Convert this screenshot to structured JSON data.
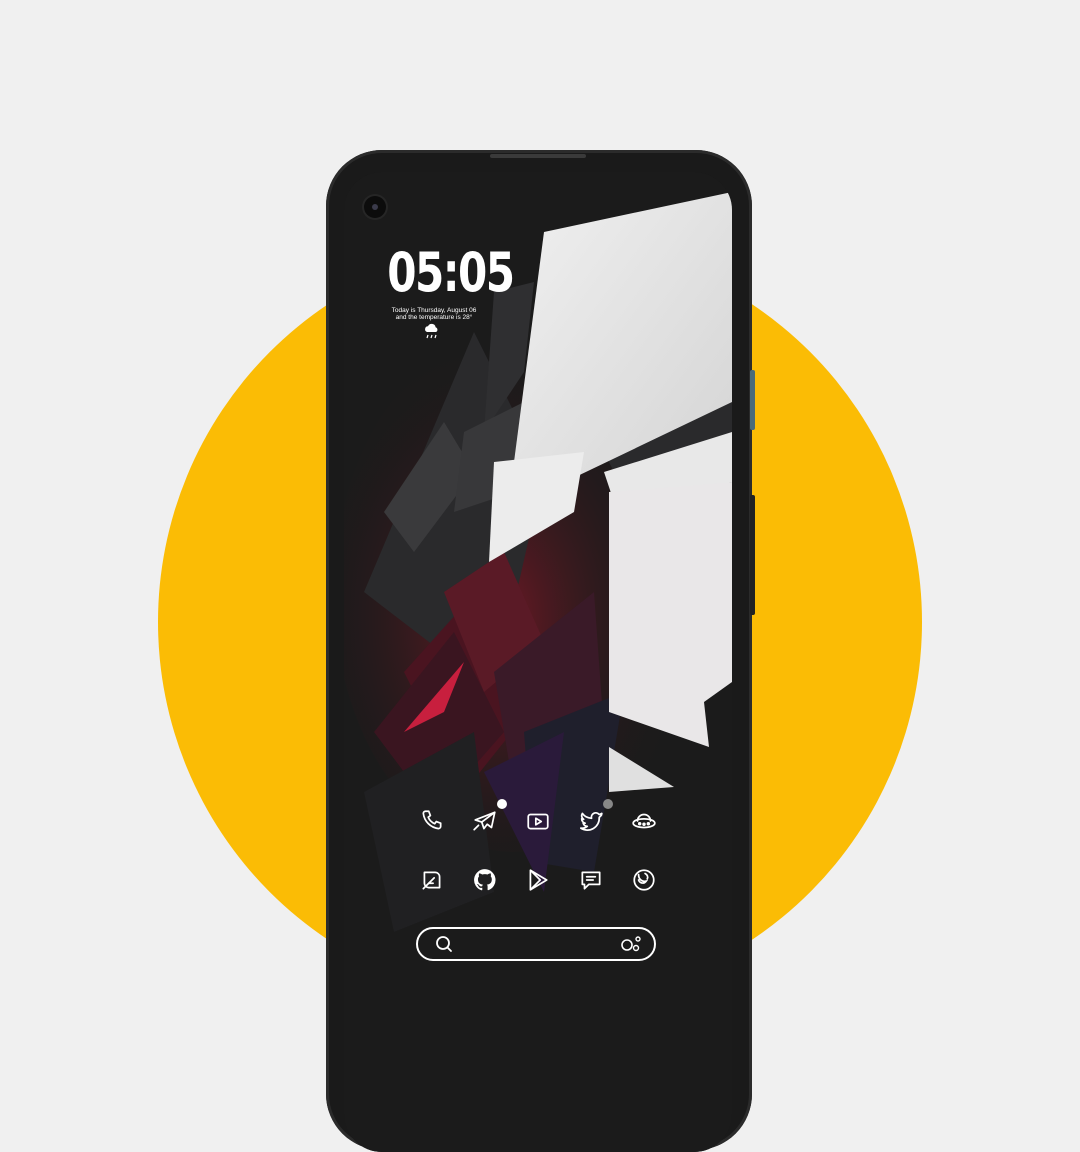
{
  "background": {
    "page": "#f0f0f0",
    "circle": "#fbbc05",
    "phone_frame": "#1a1a1a"
  },
  "lockscreen": {
    "clock": "05:05",
    "date_line1": "Today is Thursday, August 06",
    "date_line2": "and the temperature is 28°",
    "weather_icon": "cloud-rain-icon"
  },
  "dock": {
    "row1": [
      "phone-icon",
      "telegram-icon",
      "youtube-icon",
      "twitter-icon",
      "ufo-icon"
    ],
    "row2": [
      "feedly-icon",
      "github-icon",
      "play-store-icon",
      "messages-icon",
      "firefox-icon"
    ]
  },
  "search": {
    "left_icon": "search-icon",
    "right_icon": "assistant-icon"
  }
}
